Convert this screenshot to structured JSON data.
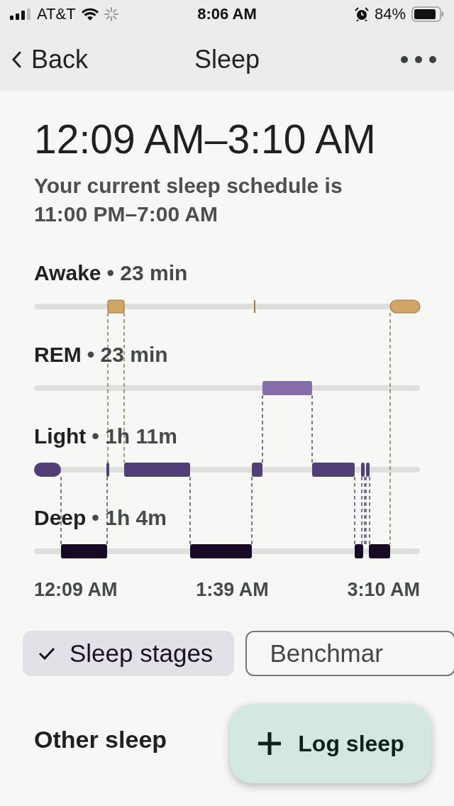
{
  "status_bar": {
    "carrier": "AT&T",
    "time": "8:06 AM",
    "battery": "84%"
  },
  "nav": {
    "back": "Back",
    "title": "Sleep"
  },
  "sleep_range": "12:09 AM–3:10 AM",
  "schedule_text": "Your current sleep schedule is 11:00 PM–7:00 AM",
  "stages": [
    {
      "name": "Awake",
      "duration": "• 23 min"
    },
    {
      "name": "REM",
      "duration": "• 23 min"
    },
    {
      "name": "Light",
      "duration": "• 1h 11m"
    },
    {
      "name": "Deep",
      "duration": "• 1h 4m"
    }
  ],
  "time_axis": [
    "12:09 AM",
    "1:39 AM",
    "3:10 AM"
  ],
  "chips": [
    {
      "label": "Sleep stages",
      "selected": true
    },
    {
      "label": "Benchmar",
      "selected": false
    }
  ],
  "fab": {
    "label": "Log sleep"
  },
  "section_title": "Other sleep"
}
